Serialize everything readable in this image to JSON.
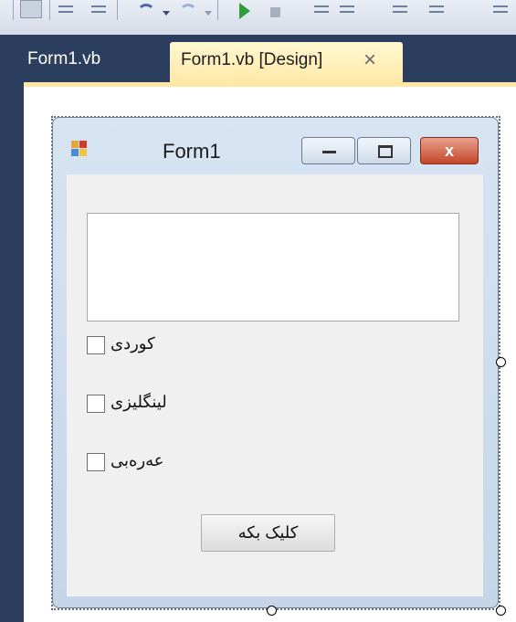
{
  "tabs": {
    "inactive_label": "Form1.vb",
    "active_label": "Form1.vb [Design]",
    "close_glyph": "×"
  },
  "form": {
    "title": "Form1",
    "close_glyph": "x"
  },
  "checkboxes": [
    {
      "label": "کوردی",
      "checked": false
    },
    {
      "label": "لینگلیزی",
      "checked": false
    },
    {
      "label": "عەرەبی",
      "checked": false
    }
  ],
  "button": {
    "label": "کلیک بکە"
  },
  "colors": {
    "ide_background": "#2b3e5d",
    "active_tab": "#ffe9a8",
    "form_client": "#f0f0f0",
    "close_button": "#c4452a"
  }
}
